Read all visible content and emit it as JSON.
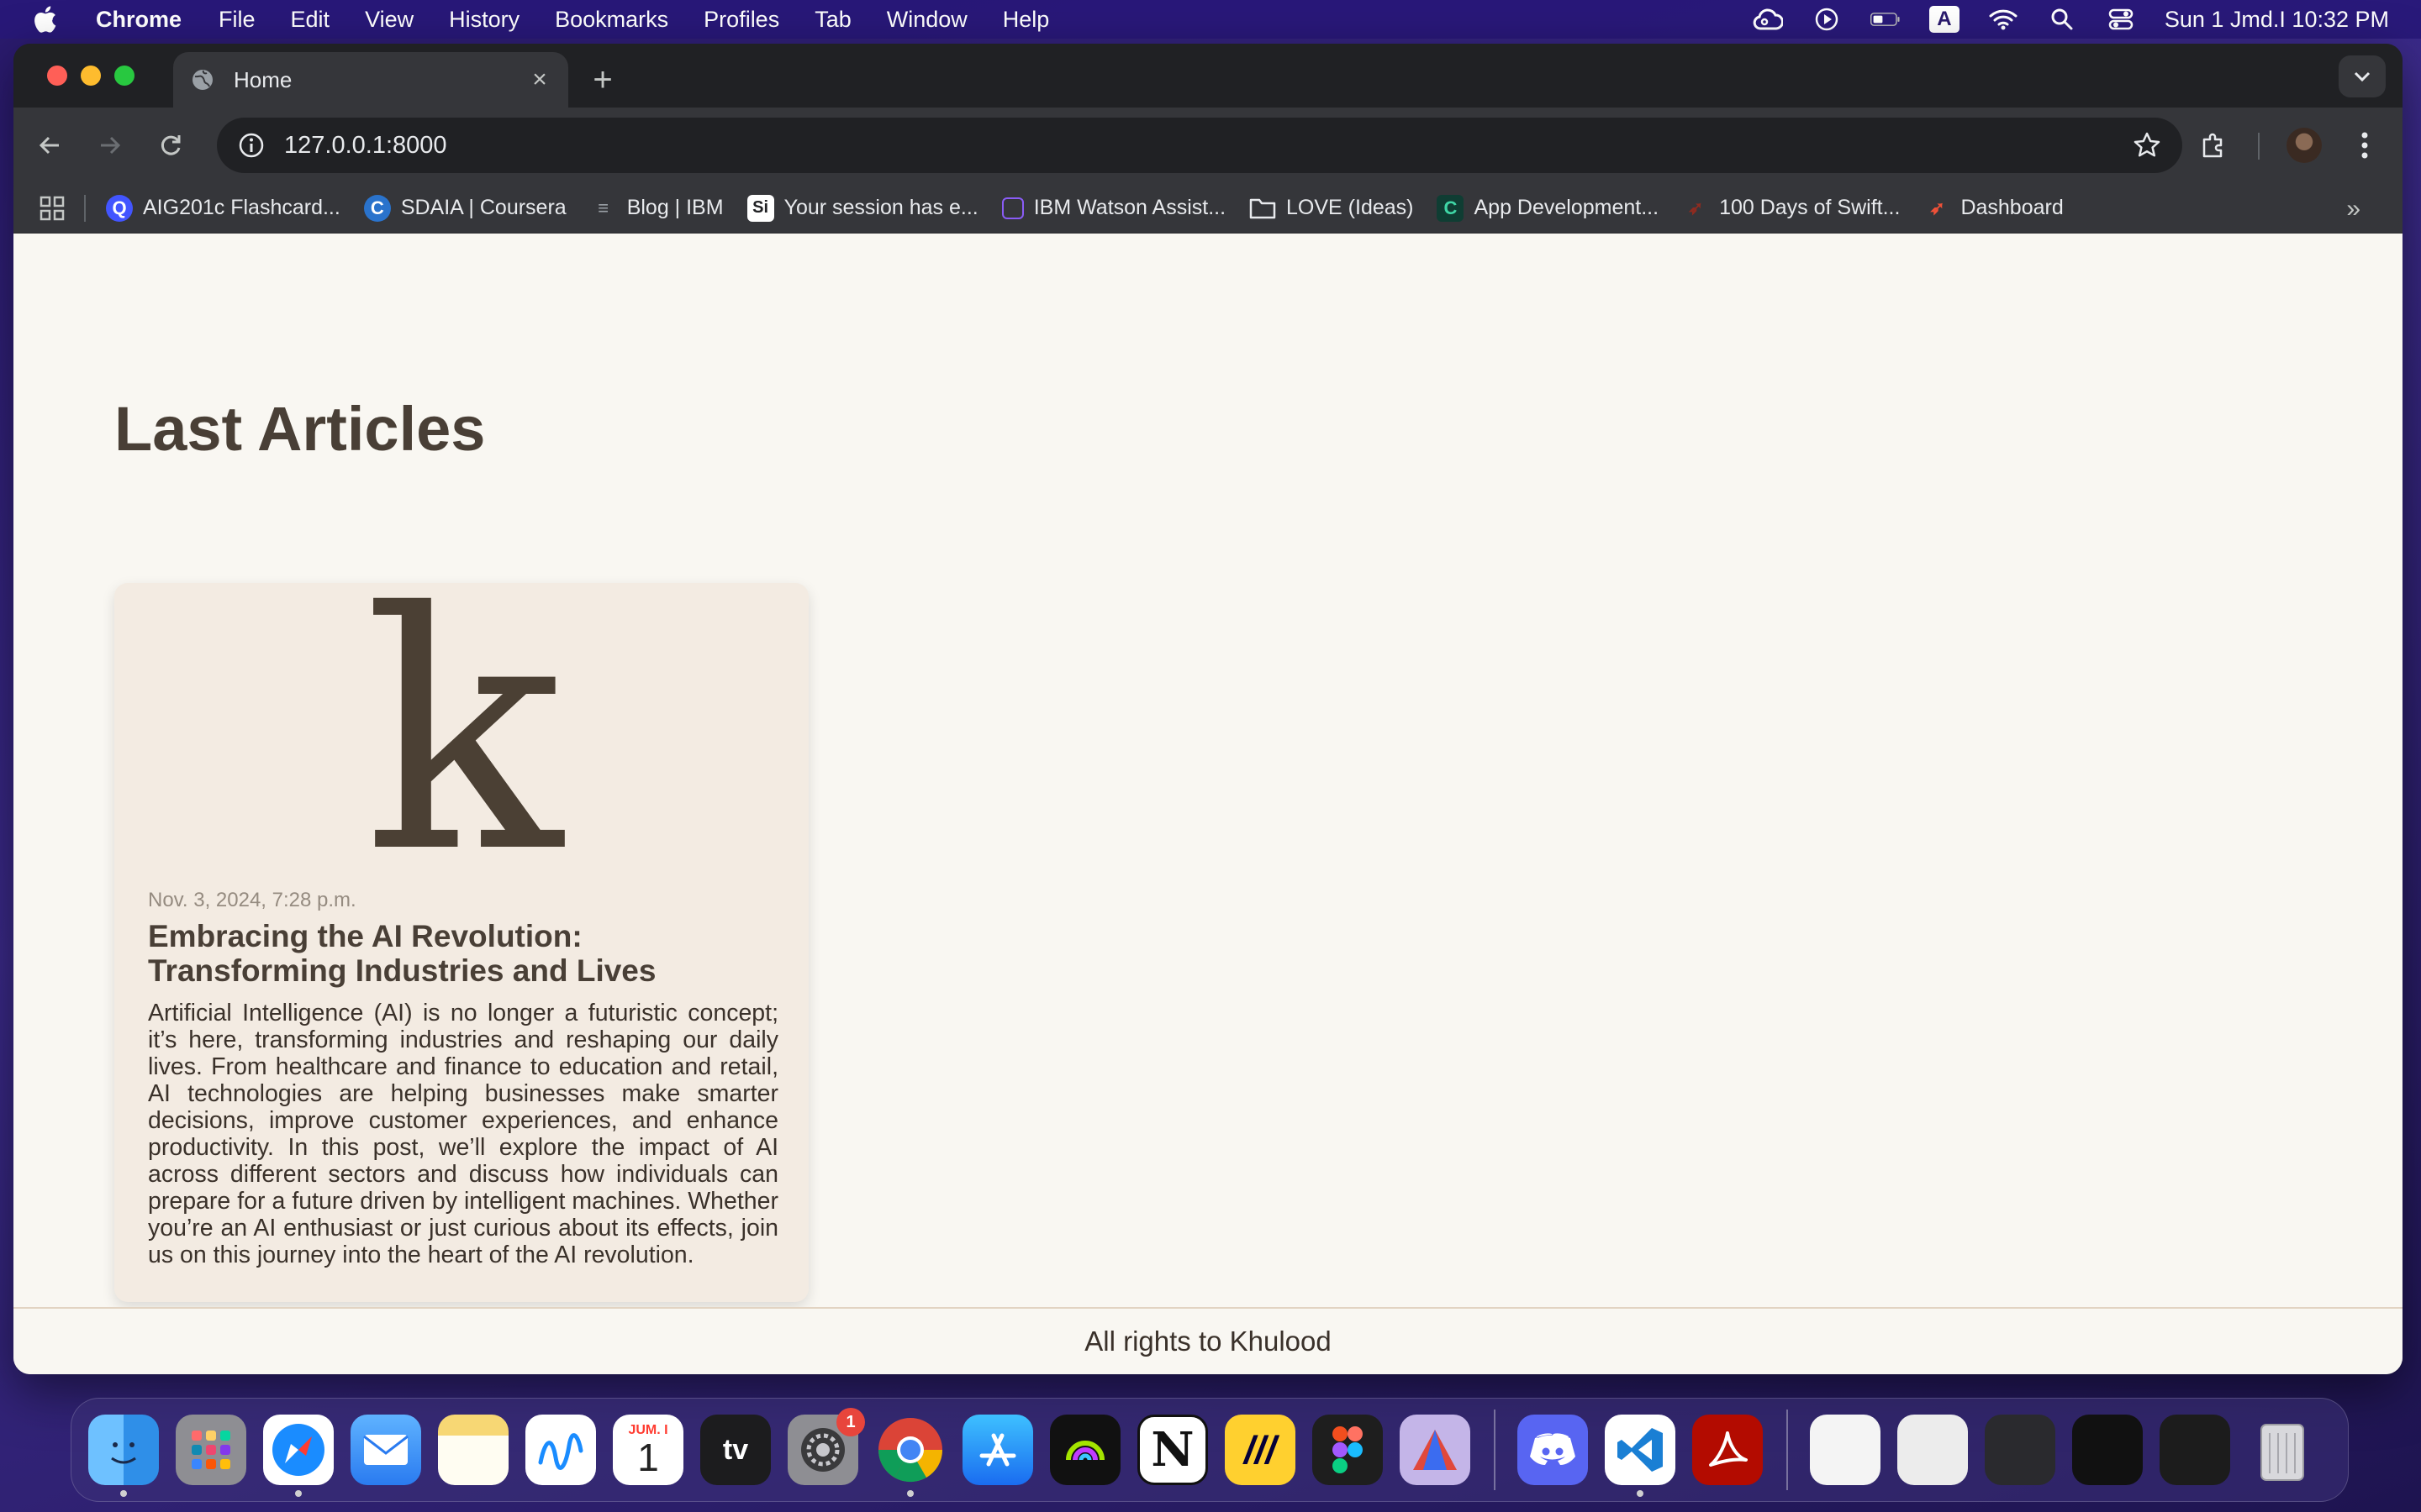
{
  "menubar": {
    "app_name": "Chrome",
    "menus": [
      "File",
      "Edit",
      "View",
      "History",
      "Bookmarks",
      "Profiles",
      "Tab",
      "Window",
      "Help"
    ],
    "input_source": "A",
    "clock": "Sun 1 Jmd.I  10:32 PM"
  },
  "browser": {
    "tab_title": "Home",
    "url": "127.0.0.1:8000",
    "bookmarks": [
      {
        "label": "AIG201c Flashcard...",
        "icon": "quizlet-icon",
        "color": "#4255ff",
        "glyph": "Q"
      },
      {
        "label": "SDAIA | Coursera",
        "icon": "coursera-icon",
        "color": "#2a73cc",
        "glyph": "C"
      },
      {
        "label": "Blog | IBM",
        "icon": "ibm-icon",
        "color": "#555555",
        "glyph": "≡"
      },
      {
        "label": "Your session has e...",
        "icon": "session-icon",
        "color": "#ffffff",
        "glyph": "S"
      },
      {
        "label": "IBM Watson Assist...",
        "icon": "watson-icon",
        "color": "#8a5cf6",
        "glyph": "◫"
      },
      {
        "label": "LOVE (Ideas)",
        "icon": "folder-icon",
        "color": "#e8eaed",
        "glyph": "▭"
      },
      {
        "label": "App Development...",
        "icon": "app-dev-icon",
        "color": "#1c8a6e",
        "glyph": "C"
      },
      {
        "label": "100 Days of Swift...",
        "icon": "swift-icon",
        "color": "#c0392b",
        "glyph": "➶"
      },
      {
        "label": "Dashboard",
        "icon": "swift-dashboard-icon",
        "color": "#f05138",
        "glyph": "➶"
      }
    ]
  },
  "page": {
    "heading": "Last Articles",
    "article": {
      "logo_letter": "k",
      "date": "Nov. 3, 2024, 7:28 p.m.",
      "title": "Embracing the AI Revolution: Transforming Industries and Lives",
      "excerpt": "Artificial Intelligence (AI) is no longer a futuristic concept; it’s here, transforming industries and reshaping our daily lives. From healthcare and finance to education and retail, AI technologies are helping businesses make smarter decisions, improve customer experiences, and enhance productivity. In this post, we’ll explore the impact of AI across different sectors and discuss how individuals can prepare for a future driven by intelligent machines. Whether you’re an AI enthusiast or just curious about its effects, join us on this journey into the heart of the AI revolution."
    },
    "footer": "All rights to Khulood"
  },
  "dock": {
    "calendar_month": "JUM. I",
    "calendar_day": "1",
    "settings_badge": "1",
    "apps": [
      {
        "name": "finder-icon",
        "color": "#2f8fe8"
      },
      {
        "name": "launchpad-icon",
        "color": "#8e8e93"
      },
      {
        "name": "safari-icon",
        "color": "#1a8cff"
      },
      {
        "name": "mail-icon",
        "color": "#3a8ef6"
      },
      {
        "name": "notes-icon",
        "color": "#f7d774"
      },
      {
        "name": "freeform-icon",
        "color": "#ffffff"
      },
      {
        "name": "calendar-icon",
        "color": "#ffffff"
      },
      {
        "name": "apple-tv-icon",
        "color": "#1c1c1e"
      },
      {
        "name": "system-settings-icon",
        "color": "#8e8e93"
      },
      {
        "name": "chrome-icon",
        "color": "#ffffff"
      },
      {
        "name": "app-store-icon",
        "color": "#1a8cff"
      },
      {
        "name": "arc-icon",
        "color": "#111111"
      },
      {
        "name": "notion-icon",
        "color": "#ffffff"
      },
      {
        "name": "miro-icon",
        "color": "#ffd02f"
      },
      {
        "name": "figma-icon",
        "color": "#1e1e1e"
      },
      {
        "name": "affinity-icon",
        "color": "#c4b5e8"
      },
      {
        "name": "discord-icon",
        "color": "#5865f2"
      },
      {
        "name": "vscode-icon",
        "color": "#ffffff"
      },
      {
        "name": "acrobat-icon",
        "color": "#b30b00"
      }
    ]
  }
}
